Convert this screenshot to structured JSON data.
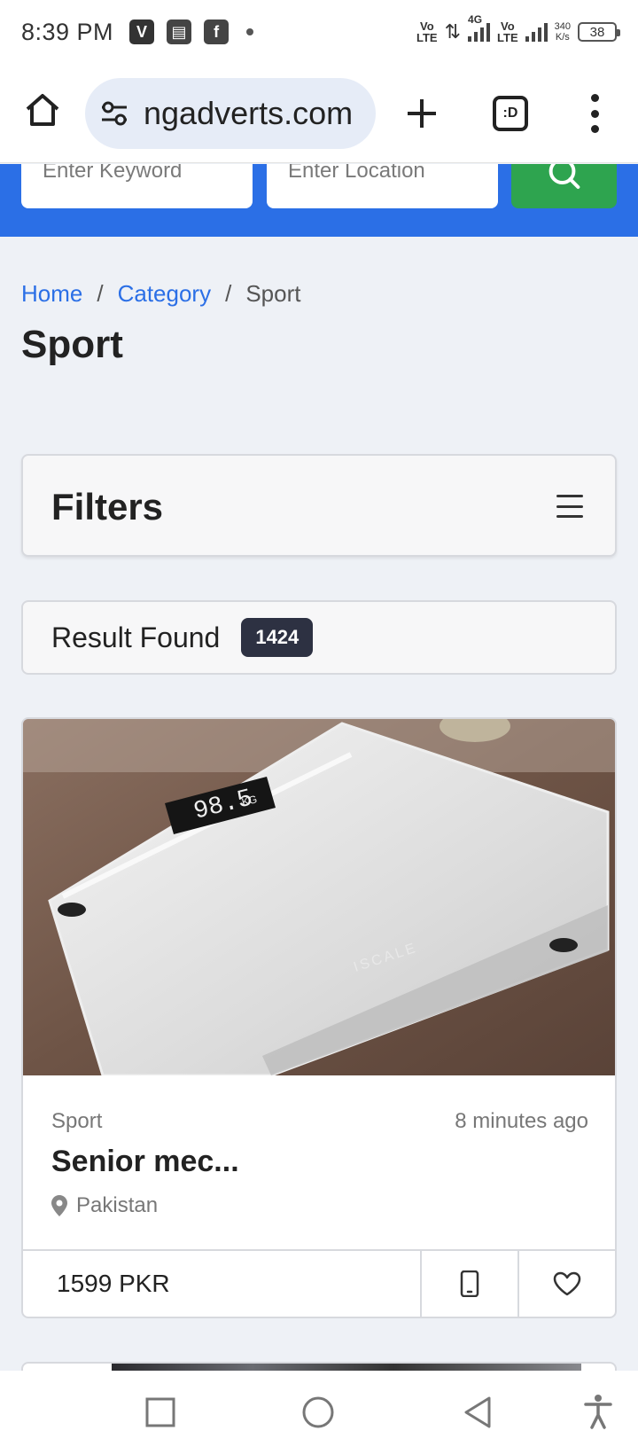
{
  "status_bar": {
    "time": "8:39 PM",
    "net1": "Vo\nLTE",
    "net2": "4G",
    "net3": "Vo\nLTE",
    "speed_value": "340",
    "speed_unit": "K/s",
    "battery": "38",
    "icons": [
      "vpn-icon",
      "sim-icon",
      "facebook-notification-icon",
      "dot-icon"
    ]
  },
  "browser": {
    "url": "ngadverts.com",
    "tabs_label": ":D"
  },
  "search": {
    "keyword_placeholder": "Enter Keyword",
    "location_placeholder": "Enter Location",
    "brand_color": "#2b6fe6",
    "button_color": "#2ea44f"
  },
  "breadcrumb": {
    "home": "Home",
    "sep1": "/",
    "category": "Category",
    "sep2": "/",
    "current": "Sport"
  },
  "page": {
    "title": "Sport"
  },
  "filters": {
    "title": "Filters"
  },
  "results": {
    "label": "Result Found",
    "count": "1424"
  },
  "listing": {
    "category": "Sport",
    "time_ago": "8 minutes ago",
    "title": "Senior mec...",
    "location": "Pakistan",
    "price": "1599 PKR",
    "image_subject": "digital bathroom scale",
    "scale_display": "98.5",
    "scale_unit": "KG",
    "scale_brand": "ISCALE"
  }
}
